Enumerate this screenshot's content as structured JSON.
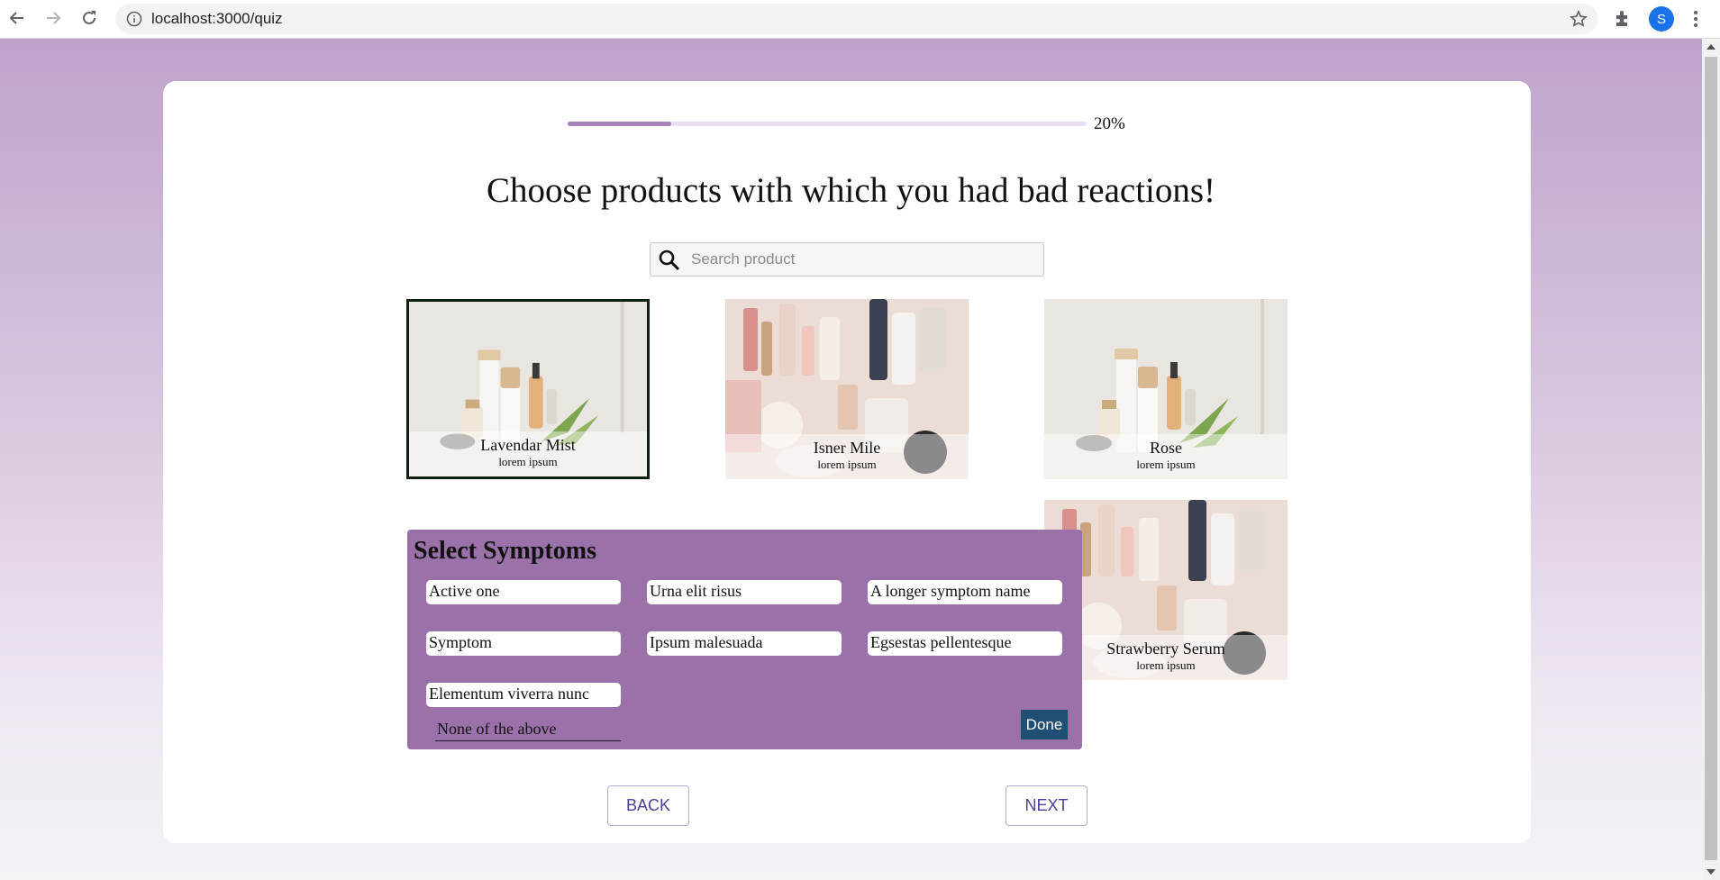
{
  "browser": {
    "url": "localhost:3000/quiz",
    "profile_initial": "S"
  },
  "quiz": {
    "progress_percent": 20,
    "progress_label": "20%",
    "title": "Choose products with which you had bad reactions!",
    "search": {
      "placeholder": "Search product",
      "value": ""
    }
  },
  "products": [
    {
      "name": "Lavendar Mist",
      "subtitle": "lorem ipsum",
      "selected": true
    },
    {
      "name": "Isner Mile",
      "subtitle": "lorem ipsum",
      "selected": false
    },
    {
      "name": "Rose",
      "subtitle": "lorem ipsum",
      "selected": false
    },
    {
      "name": "Strawberry Serum",
      "subtitle": "lorem ipsum",
      "selected": false
    }
  ],
  "symptoms_popup": {
    "heading": "Select Symptoms",
    "chips": [
      "Active one",
      "Urna elit risus",
      "A longer symptom name",
      "Symptom",
      "Ipsum malesuada",
      "Egsestas pellentesque",
      "Elementum viverra nunc"
    ],
    "none_label": "None of the above",
    "done_label": "Done"
  },
  "navigation": {
    "back_label": "BACK",
    "next_label": "NEXT"
  },
  "colors": {
    "accent": "#9b71aa",
    "progress_fill": "#a884bf",
    "done_button": "#1f4f72",
    "nav_text": "#4a3f9c"
  }
}
